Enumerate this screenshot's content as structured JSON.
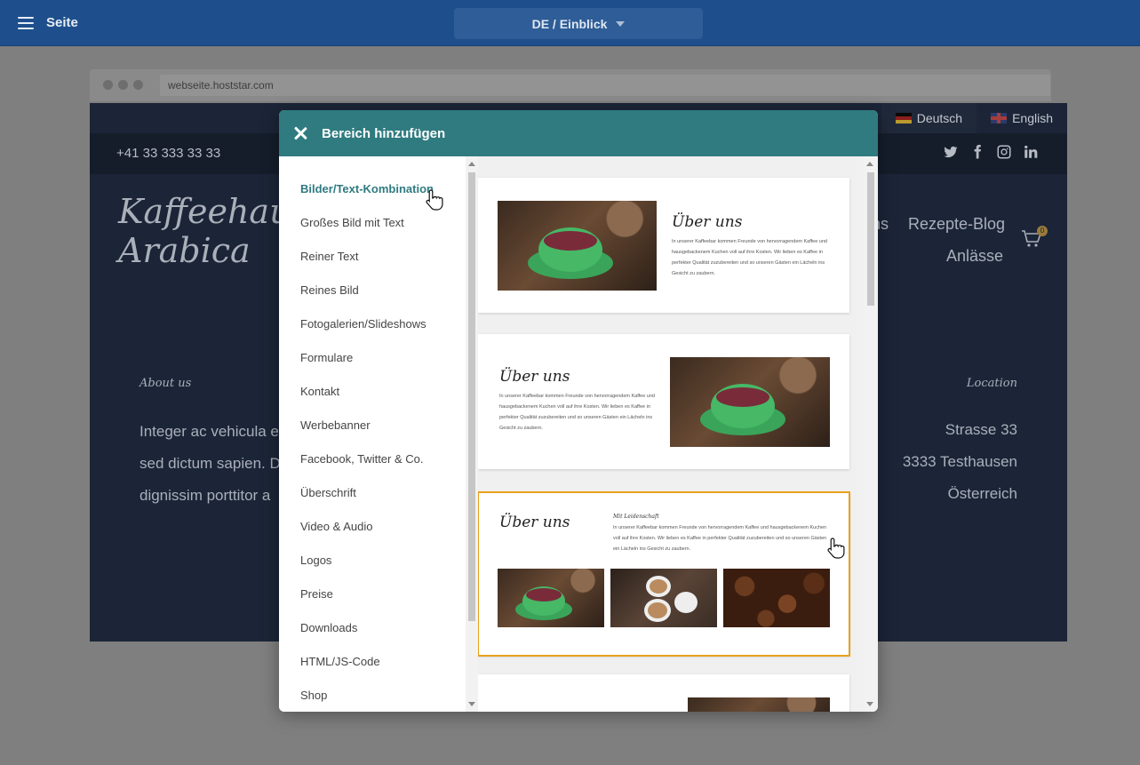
{
  "appbar": {
    "menu_label": "Seite",
    "language_selector": "DE / Einblick"
  },
  "browser": {
    "url": "webseite.hoststar.com"
  },
  "site": {
    "languages": [
      {
        "label": "Deutsch",
        "flag": "flag-de",
        "active": true
      },
      {
        "label": "English",
        "flag": "flag-en",
        "active": false
      }
    ],
    "phone": "+41 33 333 33 33",
    "socials": [
      "twitter-icon",
      "facebook-icon",
      "instagram-icon",
      "linkedin-icon"
    ],
    "logo": "Kaffeehaus Arabica",
    "nav": [
      "ns",
      "Rezepte-Blog",
      "Anlässe"
    ],
    "cart_count": "0",
    "about_heading": "About us",
    "about_lines": [
      "Integer ac vehicula e",
      "sed dictum sapien. D",
      "dignissim porttitor a"
    ],
    "location_heading": "Location",
    "location_lines": [
      "Strasse 33",
      "3333 Testhausen",
      "Österreich"
    ]
  },
  "modal": {
    "title": "Bereich hinzufügen",
    "categories": [
      "Bilder/Text-Kombination",
      "Großes Bild mit Text",
      "Reiner Text",
      "Reines Bild",
      "Fotogalerien/Slideshows",
      "Formulare",
      "Kontakt",
      "Werbebanner",
      "Facebook, Twitter & Co.",
      "Überschrift",
      "Video & Audio",
      "Logos",
      "Preise",
      "Downloads",
      "HTML/JS-Code",
      "Shop"
    ],
    "active_category": "Bilder/Text-Kombination",
    "templates": [
      {
        "heading": "Über uns",
        "text": "In unserer Kaffeebar kommen Freunde von hervorragendem Kaffee und hausgebackenem Kuchen voll auf ihre Kosten. Wir lieben es Kaffee in perfekter Qualität zuzubereiten und so unseren Gästen ein Lächeln ins Gesicht zu zaubern."
      },
      {
        "heading": "Über uns",
        "text": "In unserer Kaffeebar kommen Freunde von hervorragendem Kaffee und hausgebackenem Kuchen voll auf ihre Kosten. Wir lieben es Kaffee in perfekter Qualität zuzubereiten und so unseren Gästen ein Lächeln ins Gesicht zu zaubern."
      },
      {
        "heading": "Über uns",
        "subheading": "Mit Leidenschaft",
        "text": "In unserer Kaffeebar kommen Freunde von hervorragendem Kaffee und hausgebackenem Kuchen voll auf ihre Kosten. Wir lieben es Kaffee in perfekter Qualität zuzubereiten und so unseren Gästen ein Lächeln ins Gesicht zu zaubern.",
        "selected": true
      }
    ]
  },
  "colors": {
    "appbar": "#1e4f8c",
    "modal_header": "#2f7b80",
    "selected_outline": "#e8a21c"
  }
}
